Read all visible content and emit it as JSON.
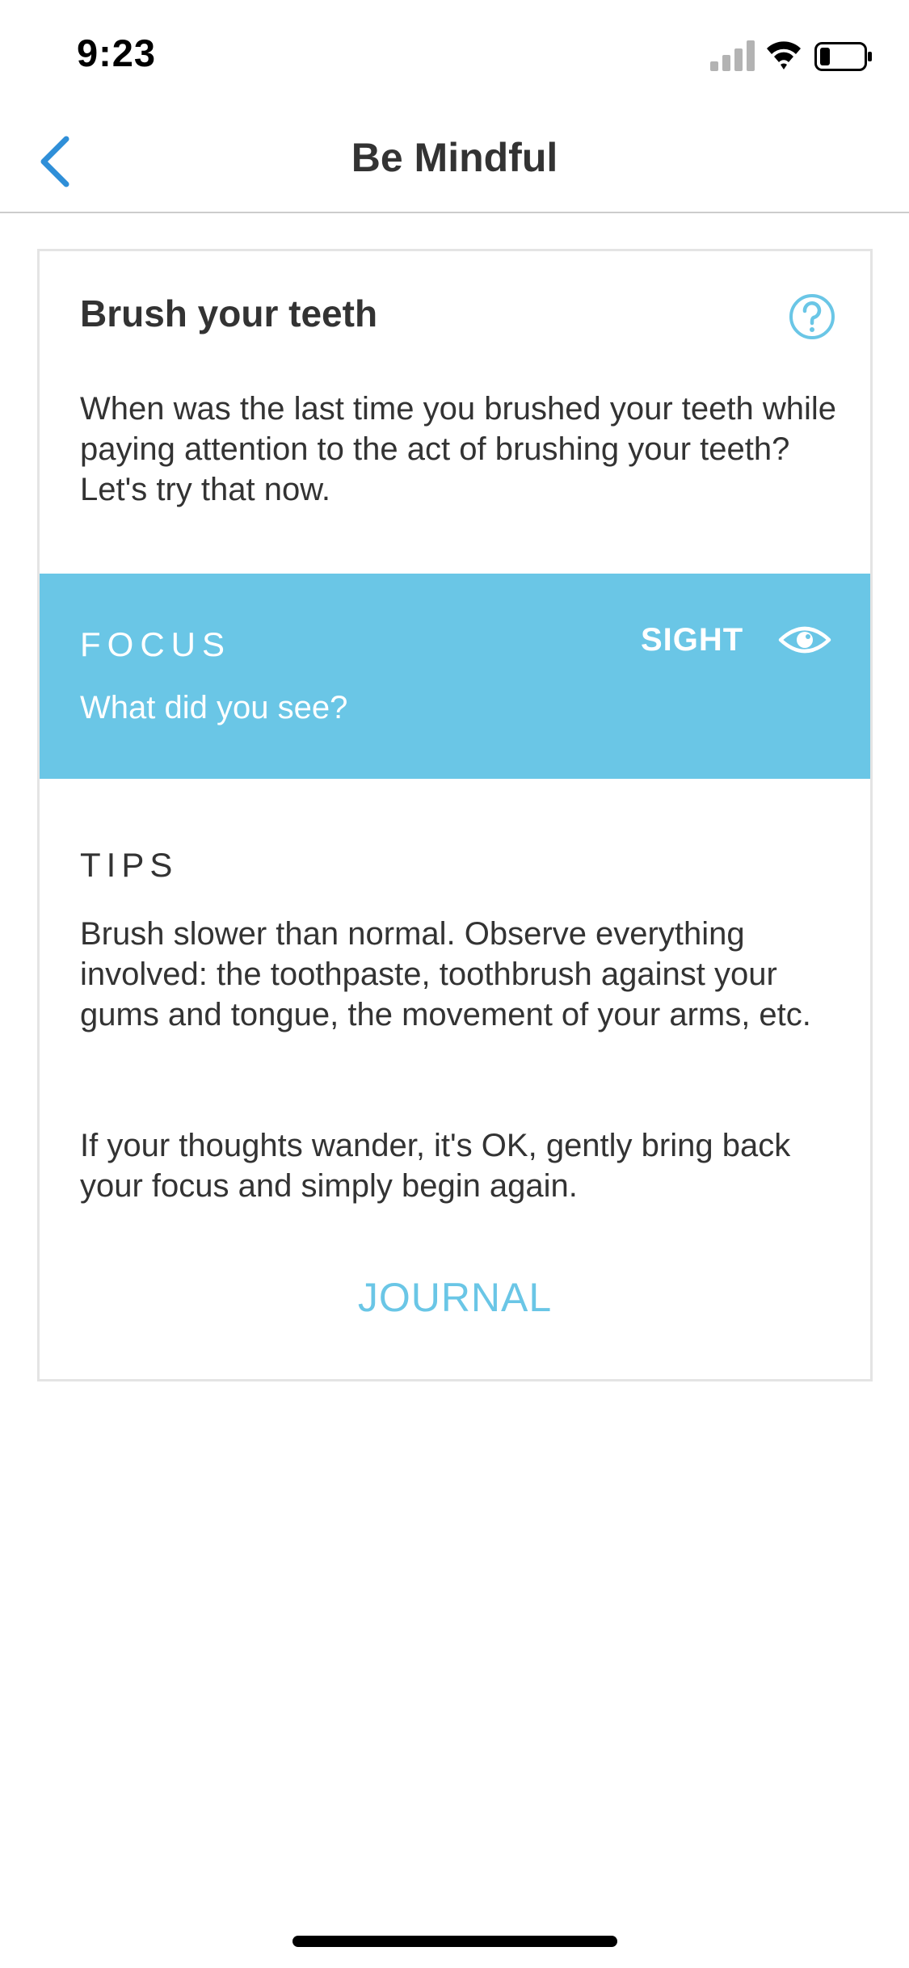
{
  "status_bar": {
    "time": "9:23"
  },
  "nav": {
    "back_icon": "chevron-left-icon",
    "title": "Be Mindful"
  },
  "card": {
    "title": "Brush your teeth",
    "help_icon": "question-circle-icon",
    "description": "When was the last time you brushed your teeth while paying attention to the act of brushing your teeth? Let's try that now.",
    "focus": {
      "label": "FOCUS",
      "question": "What did you see?",
      "sense": "SIGHT",
      "sense_icon": "eye-icon"
    },
    "tips": {
      "label": "TIPS",
      "paragraph_1": "Brush slower than normal. Observe everything involved: the toothpaste, toothbrush against your gums and tongue, the movement of your arms, etc.",
      "paragraph_2": "If your thoughts wander, it's OK, gently bring back your focus and simply begin again."
    },
    "journal_label": "JOURNAL"
  },
  "colors": {
    "accent": "#6ac6e6",
    "back_chevron": "#2f8fd8",
    "text": "#333333"
  }
}
